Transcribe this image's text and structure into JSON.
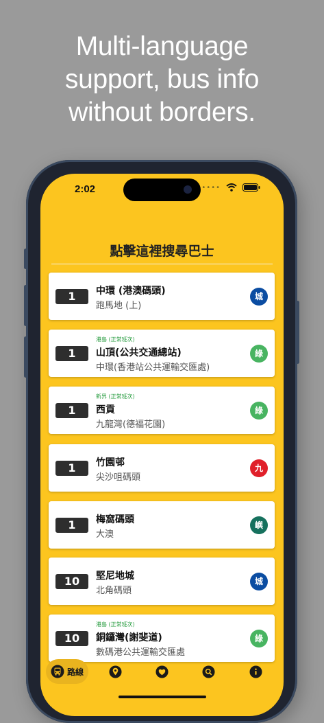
{
  "marketing": {
    "headline_line1": "Multi-language",
    "headline_line2": "support, bus info",
    "headline_line3": "without borders."
  },
  "status": {
    "time": "2:02"
  },
  "header": {
    "title": "點擊這裡搜尋巴士"
  },
  "routes": [
    {
      "route": "1",
      "note": "",
      "dest": "中環 (港澳碼頭)",
      "origin": "跑馬地 (上)",
      "company": "城",
      "color": "#0b4da2"
    },
    {
      "route": "1",
      "note": "港島 (正常班次)",
      "dest": "山頂(公共交通總站)",
      "origin": "中環(香港站公共運輸交匯處)",
      "company": "綠",
      "color": "#48b461"
    },
    {
      "route": "1",
      "note": "新界 (正常班次)",
      "dest": "西貢",
      "origin": "九龍灣(德福花園)",
      "company": "綠",
      "color": "#48b461"
    },
    {
      "route": "1",
      "note": "",
      "dest": "竹園邨",
      "origin": "尖沙咀碼頭",
      "company": "九",
      "color": "#e0202a"
    },
    {
      "route": "1",
      "note": "",
      "dest": "梅窩碼頭",
      "origin": "大澳",
      "company": "嶼",
      "color": "#16715e"
    },
    {
      "route": "10",
      "note": "",
      "dest": "堅尼地城",
      "origin": "北角碼頭",
      "company": "城",
      "color": "#0b4da2"
    },
    {
      "route": "10",
      "note": "港島 (正常班次)",
      "dest": "銅鑼灣(謝斐道)",
      "origin": "數碼港公共運輸交匯處",
      "company": "綠",
      "color": "#48b461"
    }
  ],
  "tabs": {
    "routes_label": "路線"
  },
  "icons": [
    "bus-icon",
    "location-pin-icon",
    "heart-icon",
    "search-icon",
    "info-icon",
    "wifi-icon",
    "battery-icon"
  ]
}
